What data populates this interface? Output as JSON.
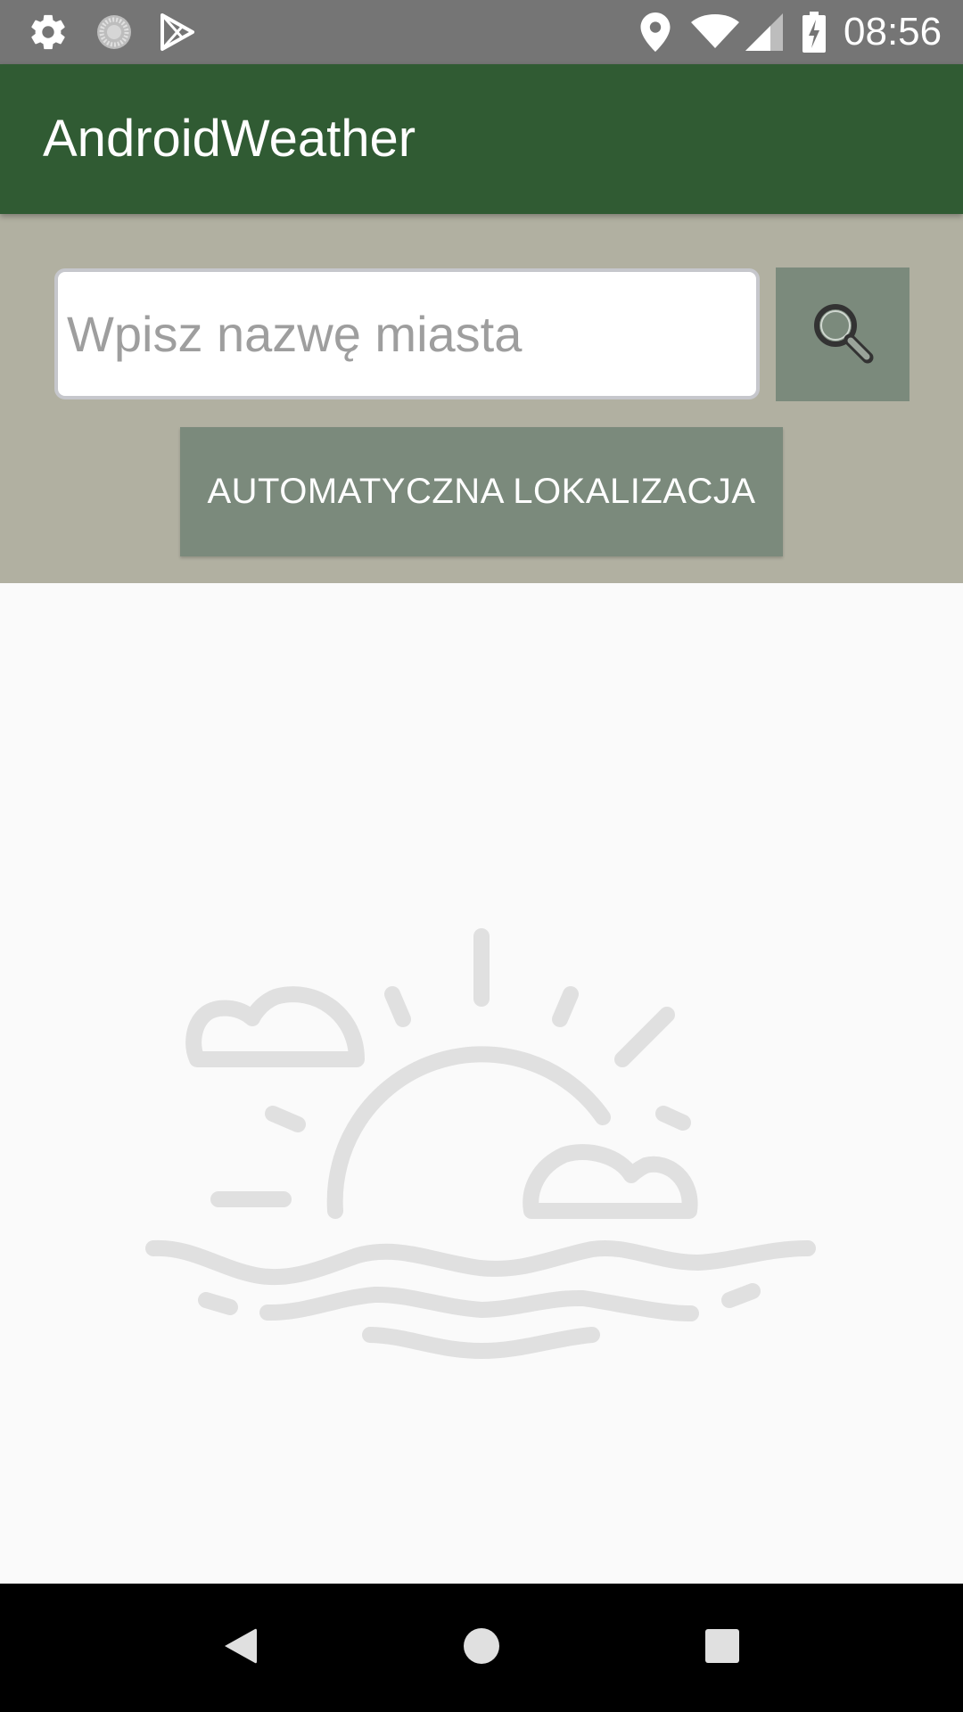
{
  "status_bar": {
    "time": "08:56",
    "icons": [
      "gear-icon",
      "sync-icon",
      "play-store-icon",
      "location-icon",
      "wifi-icon",
      "signal-icon",
      "battery-charging-icon"
    ]
  },
  "app_bar": {
    "title": "AndroidWeather",
    "color": "#305b33"
  },
  "search": {
    "placeholder": "Wpisz nazwę miasta",
    "value": "",
    "button_icon": "search-icon",
    "button_color": "#7b8a7c",
    "panel_color": "#b1b0a1"
  },
  "auto_location": {
    "label": "AUTOMATYCZNA LOKALIZACJA"
  },
  "illustration": {
    "icon": "sunset-over-sea-icon",
    "color": "#e0e0e0"
  },
  "nav_bar": {
    "buttons": [
      "back-icon",
      "home-icon",
      "recents-icon"
    ]
  }
}
